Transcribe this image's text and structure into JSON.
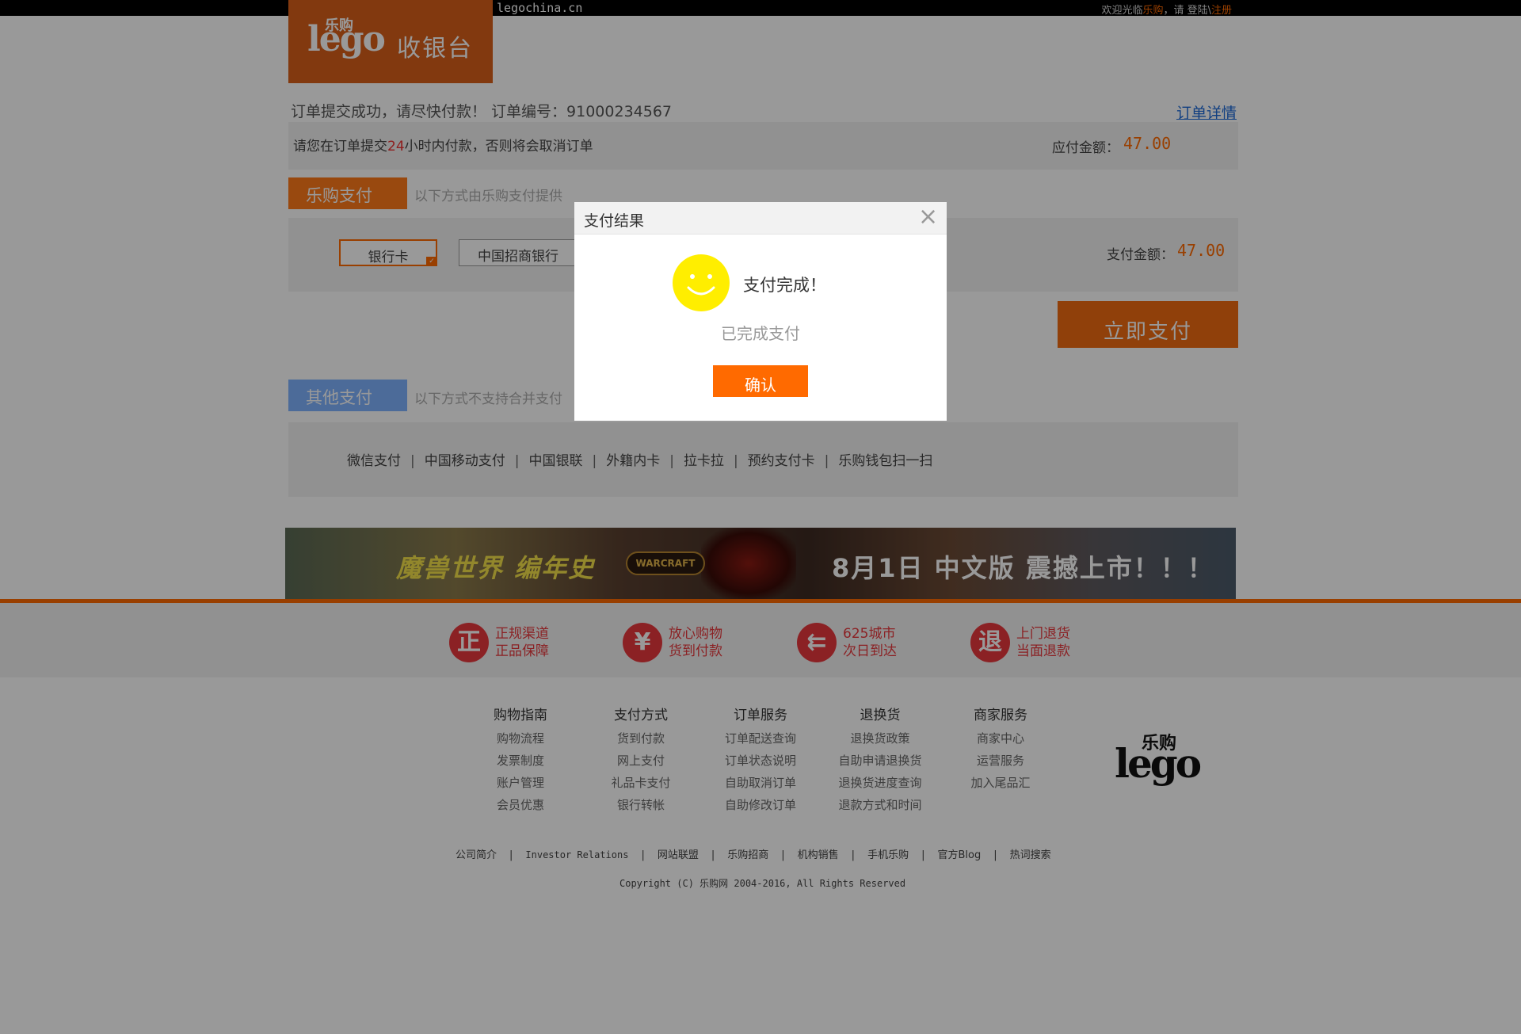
{
  "topbar": {
    "domain": "legochina.cn",
    "welcome_prefix": "欢迎光临",
    "welcome_brand": "乐购",
    "welcome_mid": "，请 登陆\\",
    "register": "注册"
  },
  "logo": {
    "brand_cn": "乐购",
    "brand_en": "lego",
    "page_title": "收银台"
  },
  "order": {
    "success_text": "订单提交成功，请尽快付款！  订单编号：91000234567",
    "detail_link": "订单详情",
    "warn_prefix": "请您在订单提交",
    "warn_hours": "24",
    "warn_suffix": "小时内付款，否则将会取消订单",
    "amount_label": "应付金额：",
    "amount_value": "47.00"
  },
  "lego_pay": {
    "header": "乐购支付",
    "note": "以下方式由乐购支付提供",
    "options": [
      "银行卡",
      "中国招商银行"
    ],
    "amount_label": "支付金额：",
    "amount_value": "47.00",
    "pay_button": "立即支付"
  },
  "other_pay": {
    "header": "其他支付",
    "note": "以下方式不支持合并支付",
    "methods": [
      "微信支付",
      "中国移动支付",
      "中国银联",
      "外籍内卡",
      "拉卡拉",
      "预约支付卡",
      "乐购钱包扫一扫"
    ]
  },
  "banner": {
    "left_text": "魔兽世界 编年史",
    "logo_text": "WARCRAFT",
    "right_text": "8月1日 中文版 震撼上市！！！"
  },
  "guarantees": [
    {
      "icon": "正",
      "line1": "正规渠道",
      "line2": "正品保障"
    },
    {
      "icon": "¥",
      "line1": "放心购物",
      "line2": "货到付款"
    },
    {
      "icon": "⇇",
      "line1": "625城市",
      "line2": "次日到达"
    },
    {
      "icon": "退",
      "line1": "上门退货",
      "line2": "当面退款"
    }
  ],
  "help": [
    {
      "title": "购物指南",
      "items": [
        "购物流程",
        "发票制度",
        "账户管理",
        "会员优惠"
      ]
    },
    {
      "title": "支付方式",
      "items": [
        "货到付款",
        "网上支付",
        "礼品卡支付",
        "银行转帐"
      ]
    },
    {
      "title": "订单服务",
      "items": [
        "订单配送查询",
        "订单状态说明",
        "自助取消订单",
        "自助修改订单"
      ]
    },
    {
      "title": "退换货",
      "items": [
        "退换货政策",
        "自助申请退换货",
        "退换货进度查询",
        "退款方式和时间"
      ]
    },
    {
      "title": "商家服务",
      "items": [
        "商家中心",
        "运营服务",
        "加入尾品汇"
      ]
    }
  ],
  "footer_links": [
    "公司简介",
    "Investor Relations",
    "网站联盟",
    "乐购招商",
    "机构销售",
    "手机乐购",
    "官方Blog",
    "热词搜索"
  ],
  "copyright": "Copyright (C) 乐购网 2004-2016, All Rights Reserved",
  "dialog": {
    "title": "支付结果",
    "close": "×",
    "message": "支付完成！",
    "sub_message": "已完成支付",
    "confirm": "确认"
  },
  "colors": {
    "brand_orange": "#ff6a00",
    "logo_orange": "#d9601a",
    "other_blue": "#7fb2ff",
    "guarantee_red": "#e8383d",
    "smiley_yellow": "#ffee00"
  }
}
